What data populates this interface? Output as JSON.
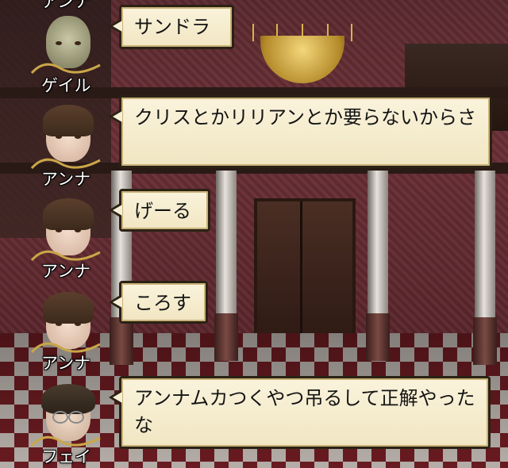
{
  "messages": [
    {
      "speaker": "ゲイル",
      "text": "サンドラ",
      "portrait": "old-man-portrait"
    },
    {
      "speaker": "アンナ",
      "text": "クリスとかリリアンとか要らないからさ",
      "portrait": "anna-portrait"
    },
    {
      "speaker": "アンナ",
      "text": "げーる",
      "portrait": "anna-portrait"
    },
    {
      "speaker": "アンナ",
      "text": "ころす",
      "portrait": "anna-portrait"
    },
    {
      "speaker": "フェイ",
      "text": "アンナムカつくやつ吊るして正解やったな",
      "portrait": "fei-portrait"
    }
  ],
  "partial_top_name": "アンナ",
  "colors": {
    "bubble_fill": "#f8f0d6",
    "bubble_border": "#2b2114",
    "name_text": "#ffffff",
    "wall": "#6b3037"
  }
}
